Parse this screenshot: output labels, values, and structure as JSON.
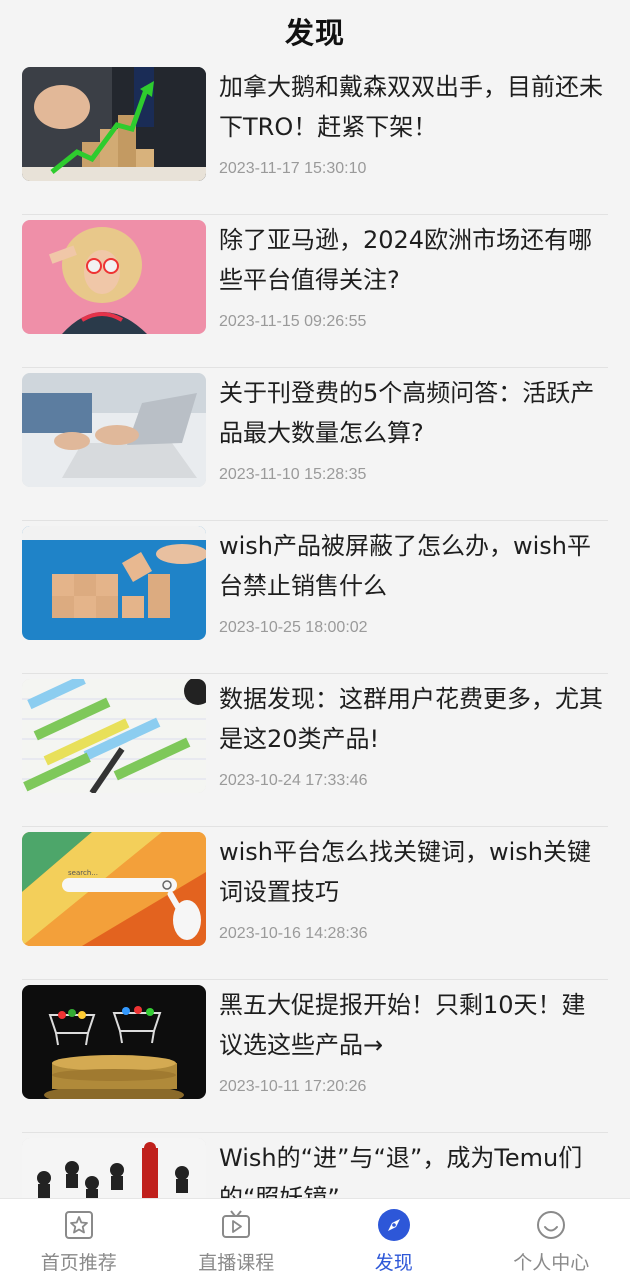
{
  "header": {
    "title": "发现"
  },
  "articles": [
    {
      "title": "加拿大鹅和戴森双双出手，目前还未下TRO！赶紧下架！",
      "date": "2023-11-17 15:30:10"
    },
    {
      "title": "除了亚马逊，2024欧洲市场还有哪些平台值得关注?",
      "date": "2023-11-15 09:26:55"
    },
    {
      "title": "关于刊登费的5个高频问答：活跃产品最大数量怎么算?",
      "date": "2023-11-10 15:28:35"
    },
    {
      "title": "wish产品被屏蔽了怎么办，wish平台禁止销售什么",
      "date": "2023-10-25 18:00:02"
    },
    {
      "title": "数据发现：这群用户花费更多，尤其是这20类产品!",
      "date": "2023-10-24 17:33:46"
    },
    {
      "title": "wish平台怎么找关键词，wish关键词设置技巧",
      "date": "2023-10-16 14:28:36"
    },
    {
      "title": "黑五大促提报开始！只剩10天！建议选这些产品→",
      "date": "2023-10-11 17:20:26"
    },
    {
      "title": "Wish的“进”与“退”，成为Temu们的“照妖镜”",
      "date": ""
    }
  ],
  "tabbar": {
    "items": [
      {
        "label": "首页推荐",
        "icon": "star-square-icon"
      },
      {
        "label": "直播课程",
        "icon": "tv-play-icon"
      },
      {
        "label": "发现",
        "icon": "compass-icon"
      },
      {
        "label": "个人中心",
        "icon": "smile-face-icon"
      }
    ],
    "active_index": 2,
    "active_color": "#2d57d8",
    "inactive_color": "#8a8a8a"
  }
}
